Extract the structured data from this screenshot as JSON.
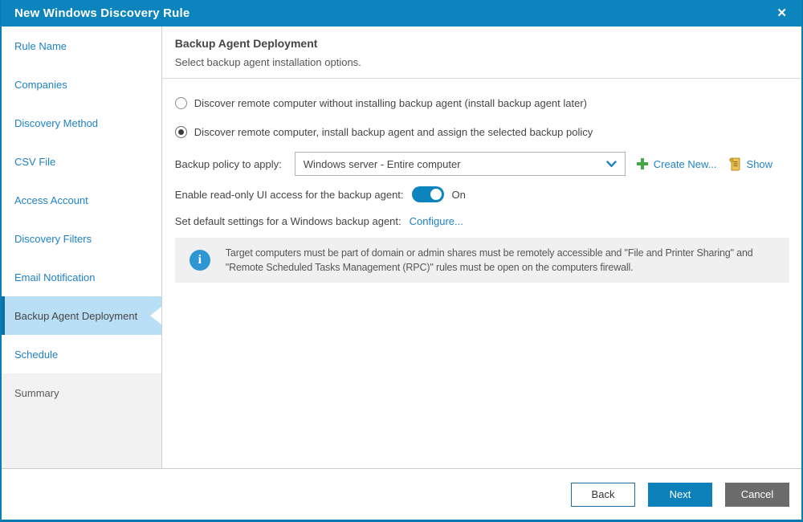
{
  "window": {
    "title": "New Windows Discovery Rule",
    "close_glyph": "✕"
  },
  "sidebar": {
    "items": [
      {
        "label": "Rule Name",
        "state": "link"
      },
      {
        "label": "Companies",
        "state": "link"
      },
      {
        "label": "Discovery Method",
        "state": "link"
      },
      {
        "label": "CSV File",
        "state": "link"
      },
      {
        "label": "Access Account",
        "state": "link"
      },
      {
        "label": "Discovery Filters",
        "state": "link"
      },
      {
        "label": "Email Notification",
        "state": "link"
      },
      {
        "label": "Backup Agent Deployment",
        "state": "active"
      },
      {
        "label": "Schedule",
        "state": "link"
      },
      {
        "label": "Summary",
        "state": "upcoming"
      }
    ]
  },
  "main": {
    "heading": "Backup Agent Deployment",
    "subheading": "Select backup agent installation options.",
    "radios": [
      {
        "label": "Discover remote computer without installing backup agent (install backup agent later)",
        "selected": false
      },
      {
        "label": "Discover remote computer, install backup agent and assign the selected backup policy",
        "selected": true
      }
    ],
    "policy": {
      "label": "Backup policy to apply:",
      "value": "Windows server - Entire computer",
      "create_new_label": "Create New...",
      "show_label": "Show"
    },
    "toggle": {
      "label": "Enable read-only UI access for the backup agent:",
      "state": "On"
    },
    "defaults": {
      "label": "Set default settings for a Windows backup agent:",
      "link": "Configure..."
    },
    "info": {
      "text": "Target computers must be part of domain or admin shares must be remotely accessible and \"File and Printer Sharing\" and \"Remote Scheduled Tasks Management (RPC)\" rules must be open on the computers firewall."
    }
  },
  "footer": {
    "back": "Back",
    "next": "Next",
    "cancel": "Cancel"
  },
  "colors": {
    "titlebar": "#0c84bd",
    "accent": "#0c80b8",
    "link": "#1e82c4",
    "active_item_bg": "#b9dff7",
    "active_accent_bar": "#0a6fa8",
    "info_bg": "#f0f0f0",
    "info_icon": "#2e96d2",
    "plus_green": "#45a845",
    "scroll_gold": "#e3b44a",
    "cancel_gray": "#6b6b6b"
  }
}
